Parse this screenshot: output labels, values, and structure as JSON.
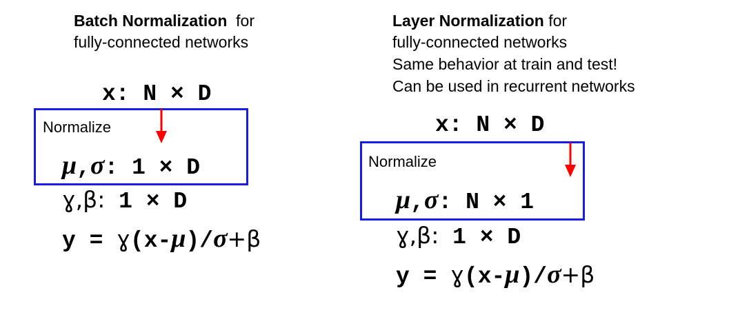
{
  "left": {
    "title_bold": "Batch Normalization",
    "title_rest": "for",
    "lines": [
      "fully-connected networks"
    ],
    "x_shape": {
      "var": "x:",
      "dims": "N × D"
    },
    "box_label": "Normalize",
    "mu_sigma": {
      "mu": "μ",
      "comma": ",",
      "sigma": "σ",
      "colon": ":",
      "dims": "1 × D"
    },
    "gamma_beta": {
      "text": "ɣ,β:",
      "dims": "1 × D"
    },
    "formula": {
      "lhs": "y = ",
      "g": "ɣ",
      "open": "(x-",
      "mu": "μ",
      "close": ")/",
      "sigma": "σ",
      "plus": "+β"
    }
  },
  "right": {
    "title_bold": "Layer Normalization",
    "title_rest": "for",
    "lines": [
      "fully-connected networks",
      "Same behavior at train and test!",
      "Can be used in recurrent networks"
    ],
    "x_shape": {
      "var": "x:",
      "dims": "N × D"
    },
    "box_label": "Normalize",
    "mu_sigma": {
      "mu": "μ",
      "comma": ",",
      "sigma": "σ",
      "colon": ":",
      "dims": "N × 1"
    },
    "gamma_beta": {
      "text": "ɣ,β:",
      "dims": "1 × D"
    },
    "formula": {
      "lhs": "y = ",
      "g": "ɣ",
      "open": "(x-",
      "mu": "μ",
      "close": ")/",
      "sigma": "σ",
      "plus": "+β"
    }
  },
  "colors": {
    "box": "#1a1ae6",
    "arrow": "#ff0000"
  }
}
